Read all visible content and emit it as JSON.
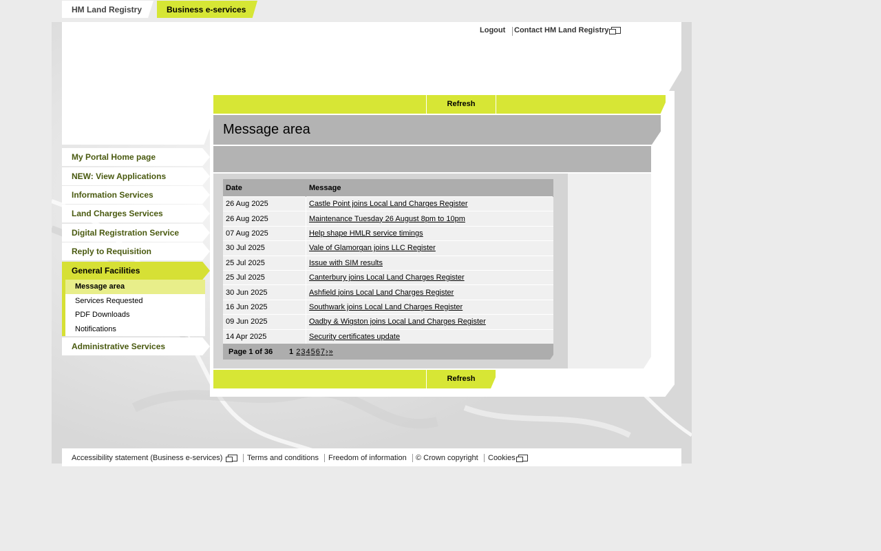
{
  "tabs": [
    {
      "label": "HM Land Registry"
    },
    {
      "label": "Business e-services"
    }
  ],
  "header": {
    "logout": "Logout",
    "contact": "Contact HM Land Registry"
  },
  "nav": {
    "items": [
      {
        "label": "My Portal Home page"
      },
      {
        "label": "NEW: View Applications"
      },
      {
        "label": "Information Services"
      },
      {
        "label": "Land Charges Services"
      },
      {
        "label": "Digital Registration Service"
      },
      {
        "label": "Reply to Requisition"
      },
      {
        "label": "General Facilities"
      },
      {
        "label": "Administrative Services"
      }
    ],
    "sub_items": [
      {
        "label": "Message area"
      },
      {
        "label": "Services Requested"
      },
      {
        "label": "PDF Downloads"
      },
      {
        "label": "Notifications"
      }
    ]
  },
  "toolbar": {
    "refresh": "Refresh"
  },
  "page": {
    "title": "Message area"
  },
  "table": {
    "headers": {
      "date": "Date",
      "message": "Message"
    },
    "rows": [
      {
        "date": "26 Aug 2025",
        "message": "Castle Point joins Local Land Charges Register"
      },
      {
        "date": "26 Aug 2025",
        "message": "Maintenance Tuesday 26 August 8pm to 10pm"
      },
      {
        "date": "07 Aug 2025",
        "message": "Help shape HMLR service timings"
      },
      {
        "date": "30 Jul 2025",
        "message": "Vale of Glamorgan joins LLC Register"
      },
      {
        "date": "25 Jul 2025",
        "message": "Issue with SIM results"
      },
      {
        "date": "25 Jul 2025",
        "message": "Canterbury joins Local Land Charges Register"
      },
      {
        "date": "30 Jun 2025",
        "message": "Ashfield joins Local Land Charges Register"
      },
      {
        "date": "16 Jun 2025",
        "message": "Southwark joins Local Land Charges Register"
      },
      {
        "date": "09 Jun 2025",
        "message": "Oadby & Wigston joins Local Land Charges Register"
      },
      {
        "date": "14 Apr 2025",
        "message": "Security certificates update"
      }
    ]
  },
  "pagination": {
    "info": "Page 1 of 36",
    "current": "1",
    "pages": [
      "2",
      "3",
      "4",
      "5",
      "6",
      "7"
    ],
    "next": "›",
    "last": "»"
  },
  "footer": {
    "accessibility": "Accessibility statement (Business e-services)",
    "terms": "Terms and conditions",
    "foi": "Freedom of information",
    "copyright": "© Crown copyright",
    "cookies": "Cookies"
  },
  "colors": {
    "accent": "#d7e635",
    "nav_text": "#4a5a10",
    "header_gray": "#b3b3b3"
  }
}
